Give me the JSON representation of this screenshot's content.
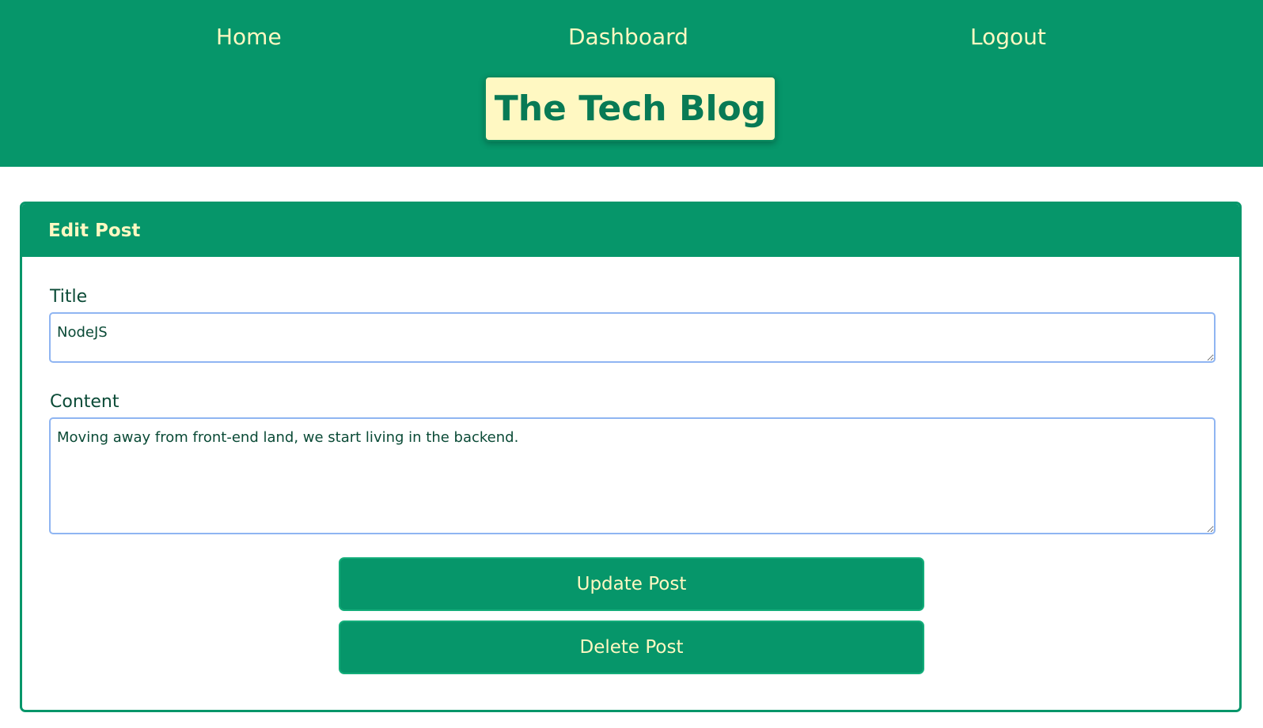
{
  "nav": {
    "home": "Home",
    "dashboard": "Dashboard",
    "logout": "Logout"
  },
  "brand": {
    "title": "The Tech Blog"
  },
  "edit_post": {
    "heading": "Edit Post",
    "title_label": "Title",
    "title_value": "NodeJS",
    "content_label": "Content",
    "content_value": "Moving away from front-end land, we start living in the backend.",
    "update_button": "Update Post",
    "delete_button": "Delete Post"
  },
  "colors": {
    "primary_green": "#06966A",
    "cream": "#FFF8C2",
    "dark_green_text": "#087A55",
    "input_border": "#8FB5F2"
  }
}
